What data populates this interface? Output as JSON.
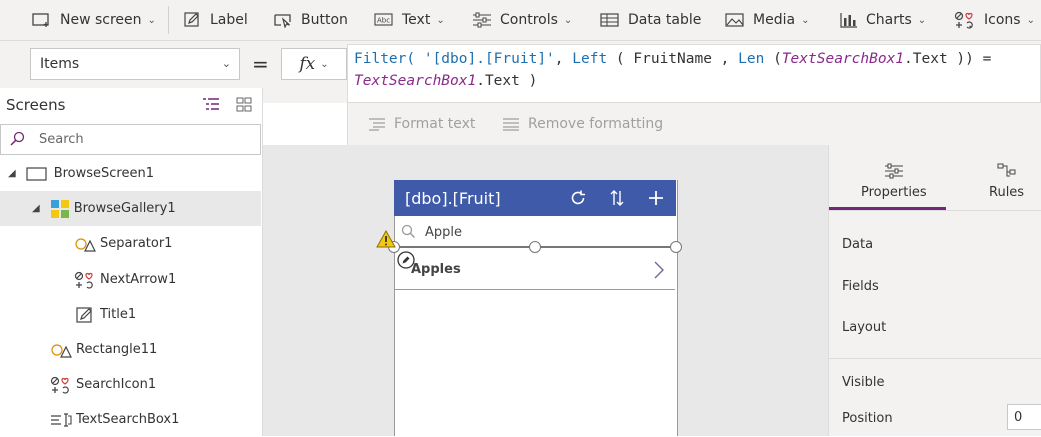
{
  "toolbar": {
    "new_screen": "New screen",
    "label": "Label",
    "button": "Button",
    "text": "Text",
    "controls": "Controls",
    "data_table": "Data table",
    "media": "Media",
    "charts": "Charts",
    "icons": "Icons"
  },
  "formula_bar": {
    "property": "Items",
    "equals": "=",
    "fx": "fx",
    "formula": {
      "filter": "Filter(",
      "table": " '[dbo].[Fruit]'",
      "comma1": ", ",
      "left": "Left",
      "paren1": " ( FruitName , ",
      "len": "Len",
      "paren2": " (",
      "ctl1": "TextSearchBox1",
      "text1": ".Text )) =",
      "ctl2": "TextSearchBox1",
      "text2": ".Text )"
    },
    "format_text": "Format text",
    "remove_formatting": "Remove formatting"
  },
  "left_panel": {
    "title": "Screens",
    "search_placeholder": "Search",
    "tree": [
      {
        "label": "BrowseScreen1"
      },
      {
        "label": "BrowseGallery1"
      },
      {
        "label": "Separator1"
      },
      {
        "label": "NextArrow1"
      },
      {
        "label": "Title1"
      },
      {
        "label": "Rectangle11"
      },
      {
        "label": "SearchIcon1"
      },
      {
        "label": "TextSearchBox1"
      }
    ]
  },
  "app": {
    "title": "[dbo].[Fruit]",
    "search_value": "Apple",
    "gallery_item": "Apples"
  },
  "right_panel": {
    "tab_properties": "Properties",
    "tab_rules": "Rules",
    "data": "Data",
    "fields": "Fields",
    "layout": "Layout",
    "visible": "Visible",
    "position": "Position",
    "position_value": "0"
  },
  "colors": {
    "accent": "#742774",
    "app_header": "#3e5aa8",
    "warning": "#f2c811"
  }
}
